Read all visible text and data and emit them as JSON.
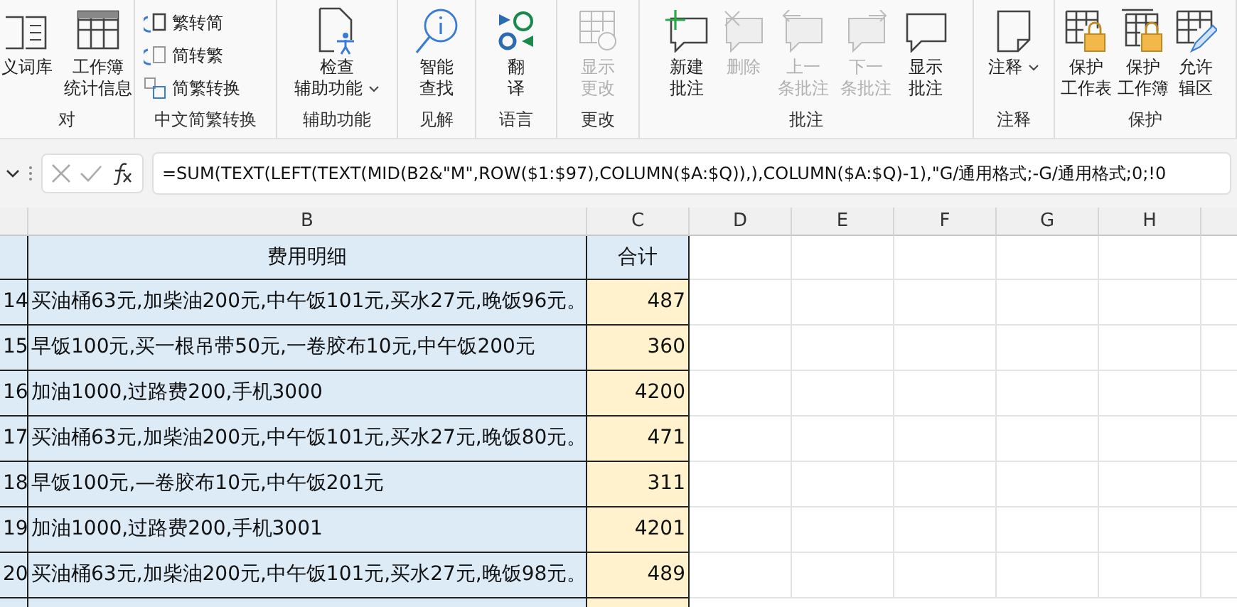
{
  "ribbon": {
    "groups": [
      {
        "label": "对",
        "buttons": [
          {
            "kind": "large",
            "lines": [
              "义词库"
            ],
            "disabled": false,
            "dropdown": false
          },
          {
            "kind": "large",
            "lines": [
              "工作簿",
              "统计信息"
            ],
            "disabled": false,
            "dropdown": false
          }
        ]
      },
      {
        "label": "中文简繁转换",
        "buttons": [
          {
            "kind": "small",
            "lines": [
              "繁转简"
            ],
            "disabled": false,
            "dropdown": false
          },
          {
            "kind": "small",
            "lines": [
              "简转繁"
            ],
            "disabled": false,
            "dropdown": false
          },
          {
            "kind": "small",
            "lines": [
              "简繁转换"
            ],
            "disabled": false,
            "dropdown": false
          }
        ]
      },
      {
        "label": "辅助功能",
        "buttons": [
          {
            "kind": "large",
            "lines": [
              "检查",
              "辅助功能"
            ],
            "disabled": false,
            "dropdown": true
          }
        ]
      },
      {
        "label": "见解",
        "buttons": [
          {
            "kind": "large",
            "lines": [
              "智能",
              "查找"
            ],
            "disabled": false,
            "dropdown": false
          }
        ]
      },
      {
        "label": "语言",
        "buttons": [
          {
            "kind": "large",
            "lines": [
              "翻",
              "译"
            ],
            "disabled": false,
            "dropdown": false
          }
        ]
      },
      {
        "label": "更改",
        "buttons": [
          {
            "kind": "large",
            "lines": [
              "显示",
              "更改"
            ],
            "disabled": true,
            "dropdown": false
          }
        ]
      },
      {
        "label": "批注",
        "buttons": [
          {
            "kind": "large",
            "lines": [
              "新建",
              "批注"
            ],
            "disabled": false,
            "dropdown": false
          },
          {
            "kind": "large",
            "lines": [
              "删除"
            ],
            "disabled": true,
            "dropdown": false
          },
          {
            "kind": "large",
            "lines": [
              "上一",
              "条批注"
            ],
            "disabled": true,
            "dropdown": false
          },
          {
            "kind": "large",
            "lines": [
              "下一",
              "条批注"
            ],
            "disabled": true,
            "dropdown": false
          },
          {
            "kind": "large",
            "lines": [
              "显示",
              "批注"
            ],
            "disabled": false,
            "dropdown": false
          }
        ]
      },
      {
        "label": "注释",
        "buttons": [
          {
            "kind": "large",
            "lines": [
              "注释"
            ],
            "disabled": false,
            "dropdown": true
          }
        ]
      },
      {
        "label": "保护",
        "buttons": [
          {
            "kind": "large",
            "lines": [
              "保护",
              "工作表"
            ],
            "disabled": false,
            "dropdown": false
          },
          {
            "kind": "large",
            "lines": [
              "保护",
              "工作簿"
            ],
            "disabled": false,
            "dropdown": false
          },
          {
            "kind": "large",
            "lines": [
              "允许",
              "辑区"
            ],
            "disabled": false,
            "dropdown": false
          }
        ]
      }
    ]
  },
  "formula_bar": {
    "formula": "=SUM(TEXT(LEFT(TEXT(MID(B2&\"M\",ROW($1:$97),COLUMN($A:$Q)),),COLUMN($A:$Q)-1),\"G/通用格式;-G/通用格式;0;!0"
  },
  "sheet": {
    "columns": [
      "B",
      "C",
      "D",
      "E",
      "F",
      "G",
      "H"
    ],
    "header": {
      "detail": "费用明细",
      "total": "合计"
    },
    "rows": [
      {
        "number": "14",
        "detail": "买油桶63元,加柴油200元,中午饭101元,买水27元,晚饭96元。",
        "total": "487"
      },
      {
        "number": "15",
        "detail": "早饭100元,买一根吊带50元,一卷胶布10元,中午饭200元",
        "total": "360"
      },
      {
        "number": "16",
        "detail": "加油1000,过路费200,手机3000",
        "total": "4200"
      },
      {
        "number": "17",
        "detail": "买油桶63元,加柴油200元,中午饭101元,买水27元,晚饭80元。",
        "total": "471"
      },
      {
        "number": "18",
        "detail": "早饭100元,—卷胶布10元,中午饭201元",
        "total": "311"
      },
      {
        "number": "19",
        "detail": "加油1000,过路费200,手机3001",
        "total": "4201"
      },
      {
        "number": "20",
        "detail": "买油桶63元,加柴油200元,中午饭101元,买水27元,晚饭98元。",
        "total": "489"
      }
    ]
  }
}
